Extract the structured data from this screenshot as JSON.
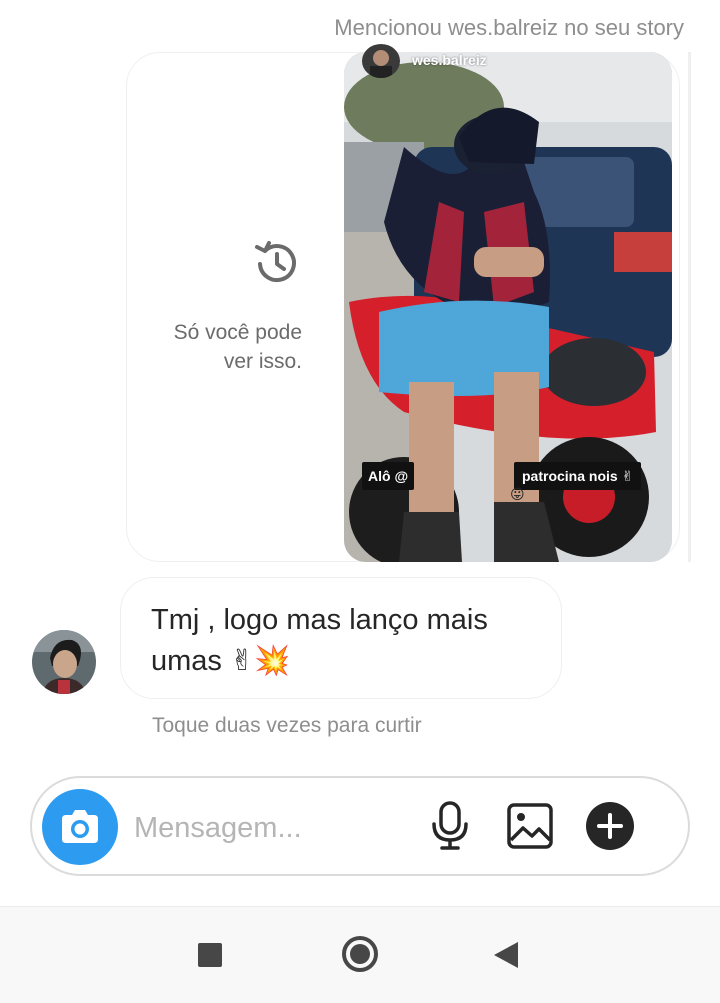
{
  "header": {
    "mention_text": "Mencionou wes.balreiz no seu story"
  },
  "story": {
    "username": "wes.balreiz",
    "expired_notice": "Só você pode ver isso.",
    "caption_left": "Alô @",
    "caption_right": "patrocina nois ✌",
    "caption_emoji": "😛"
  },
  "message": {
    "text": "Tmj , logo mas lanço mais umas ✌💥",
    "hint": "Toque duas vezes para curtir"
  },
  "composer": {
    "placeholder": "Mensagem...",
    "icons": [
      "camera-icon",
      "microphone-icon",
      "gallery-icon",
      "plus-icon"
    ]
  },
  "navigation": {
    "icons": [
      "recent-apps-icon",
      "home-icon",
      "back-icon"
    ]
  },
  "colors": {
    "accent": "#2d9cf0",
    "muted_text": "#8e8e8e",
    "border": "#efefef"
  }
}
